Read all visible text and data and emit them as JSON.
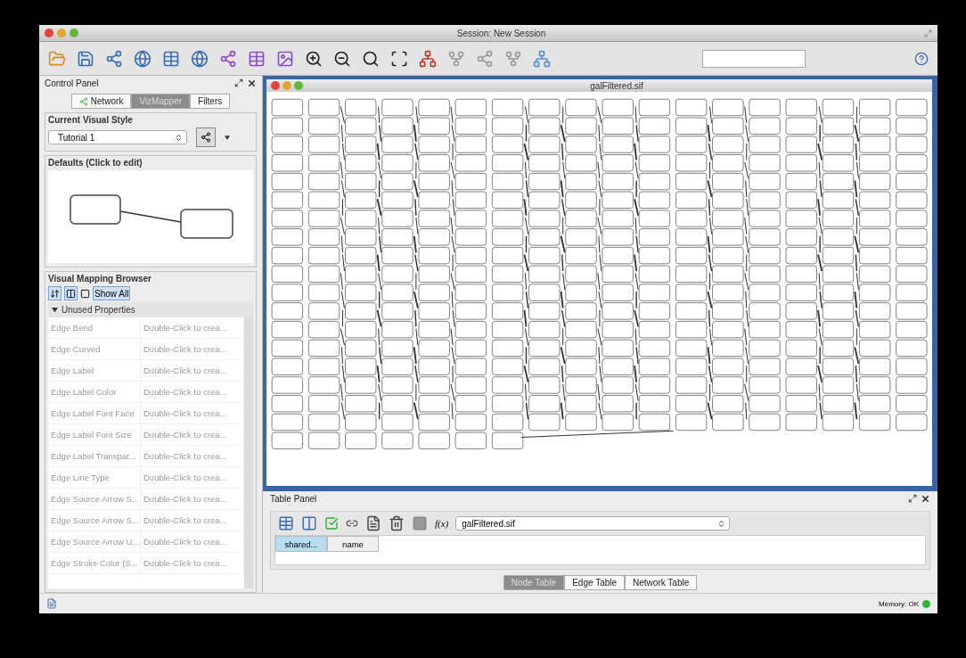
{
  "window": {
    "title": "Session: New Session"
  },
  "control_panel": {
    "title": "Control Panel",
    "tabs": [
      {
        "label": "Network",
        "selected": false
      },
      {
        "label": "VizMapper",
        "selected": true
      },
      {
        "label": "Filters",
        "selected": false
      }
    ],
    "visual_style": {
      "title": "Current Visual Style",
      "value": "Tutorial 1"
    },
    "defaults": {
      "title": "Defaults (Click to edit)"
    },
    "mapping_browser": {
      "title": "Visual Mapping Browser",
      "show_all": "Show All",
      "group": {
        "label": "Unused Properties",
        "expanded": true
      },
      "rows": [
        {
          "name": "Edge Bend",
          "value": "Double-Click to crea..."
        },
        {
          "name": "Edge Curved",
          "value": "Double-Click to crea..."
        },
        {
          "name": "Edge Label",
          "value": "Double-Click to crea..."
        },
        {
          "name": "Edge Label Color",
          "value": "Double-Click to crea..."
        },
        {
          "name": "Edge Label Font Face",
          "value": "Double-Click to crea..."
        },
        {
          "name": "Edge Label Font Size",
          "value": "Double-Click to crea..."
        },
        {
          "name": "Edge Label Transpar...",
          "value": "Double-Click to crea..."
        },
        {
          "name": "Edge Line Type",
          "value": "Double-Click to crea..."
        },
        {
          "name": "Edge Source Arrow S...",
          "value": "Double-Click to crea..."
        },
        {
          "name": "Edge Source Arrow S...",
          "value": "Double-Click to crea..."
        },
        {
          "name": "Edge Source Arrow U...",
          "value": "Double-Click to crea..."
        },
        {
          "name": "Edge Stroke Color (S...",
          "value": "Double-Click to crea..."
        }
      ]
    }
  },
  "network_window": {
    "title": "galFiltered.sif"
  },
  "table_panel": {
    "title": "Table Panel",
    "network": "galFiltered.sif",
    "function_label": "f(x)",
    "columns": [
      {
        "label": "shared...",
        "selected": true
      },
      {
        "label": "name",
        "selected": false
      }
    ],
    "tabs": [
      {
        "label": "Node Table",
        "selected": true
      },
      {
        "label": "Edge Table",
        "selected": false
      },
      {
        "label": "Network Table",
        "selected": false
      }
    ]
  },
  "status_bar": {
    "memory": "Memory: OK"
  }
}
